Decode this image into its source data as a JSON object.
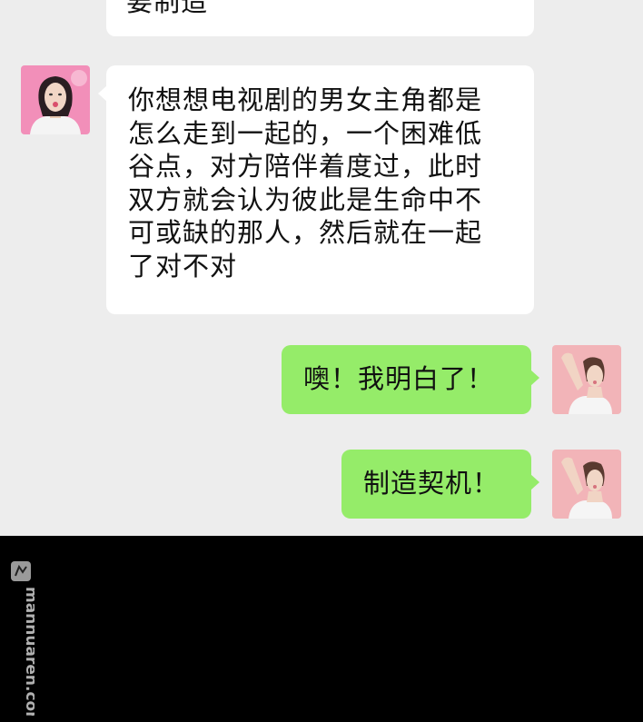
{
  "messages": [
    {
      "side": "left",
      "text": "要制造"
    },
    {
      "side": "left",
      "text": "你想想电视剧的男女主角都是\n怎么走到一起的，一个困难低\n谷点，对方陪伴着度过，此时\n双方就会认为彼此是生命中不\n可或缺的那人，然后就在一起\n了对不对"
    },
    {
      "side": "right",
      "text": "噢！我明白了！"
    },
    {
      "side": "right",
      "text": "制造契机！"
    }
  ],
  "watermark": {
    "text": "manhuaren.com"
  },
  "colors": {
    "chat_bg": "#ededed",
    "left_bubble": "#ffffff",
    "right_bubble": "#95ec69",
    "footer": "#000000"
  },
  "avatars": {
    "left": "woman-avatar-icon",
    "right": "woman-arm-raised-avatar-icon"
  }
}
